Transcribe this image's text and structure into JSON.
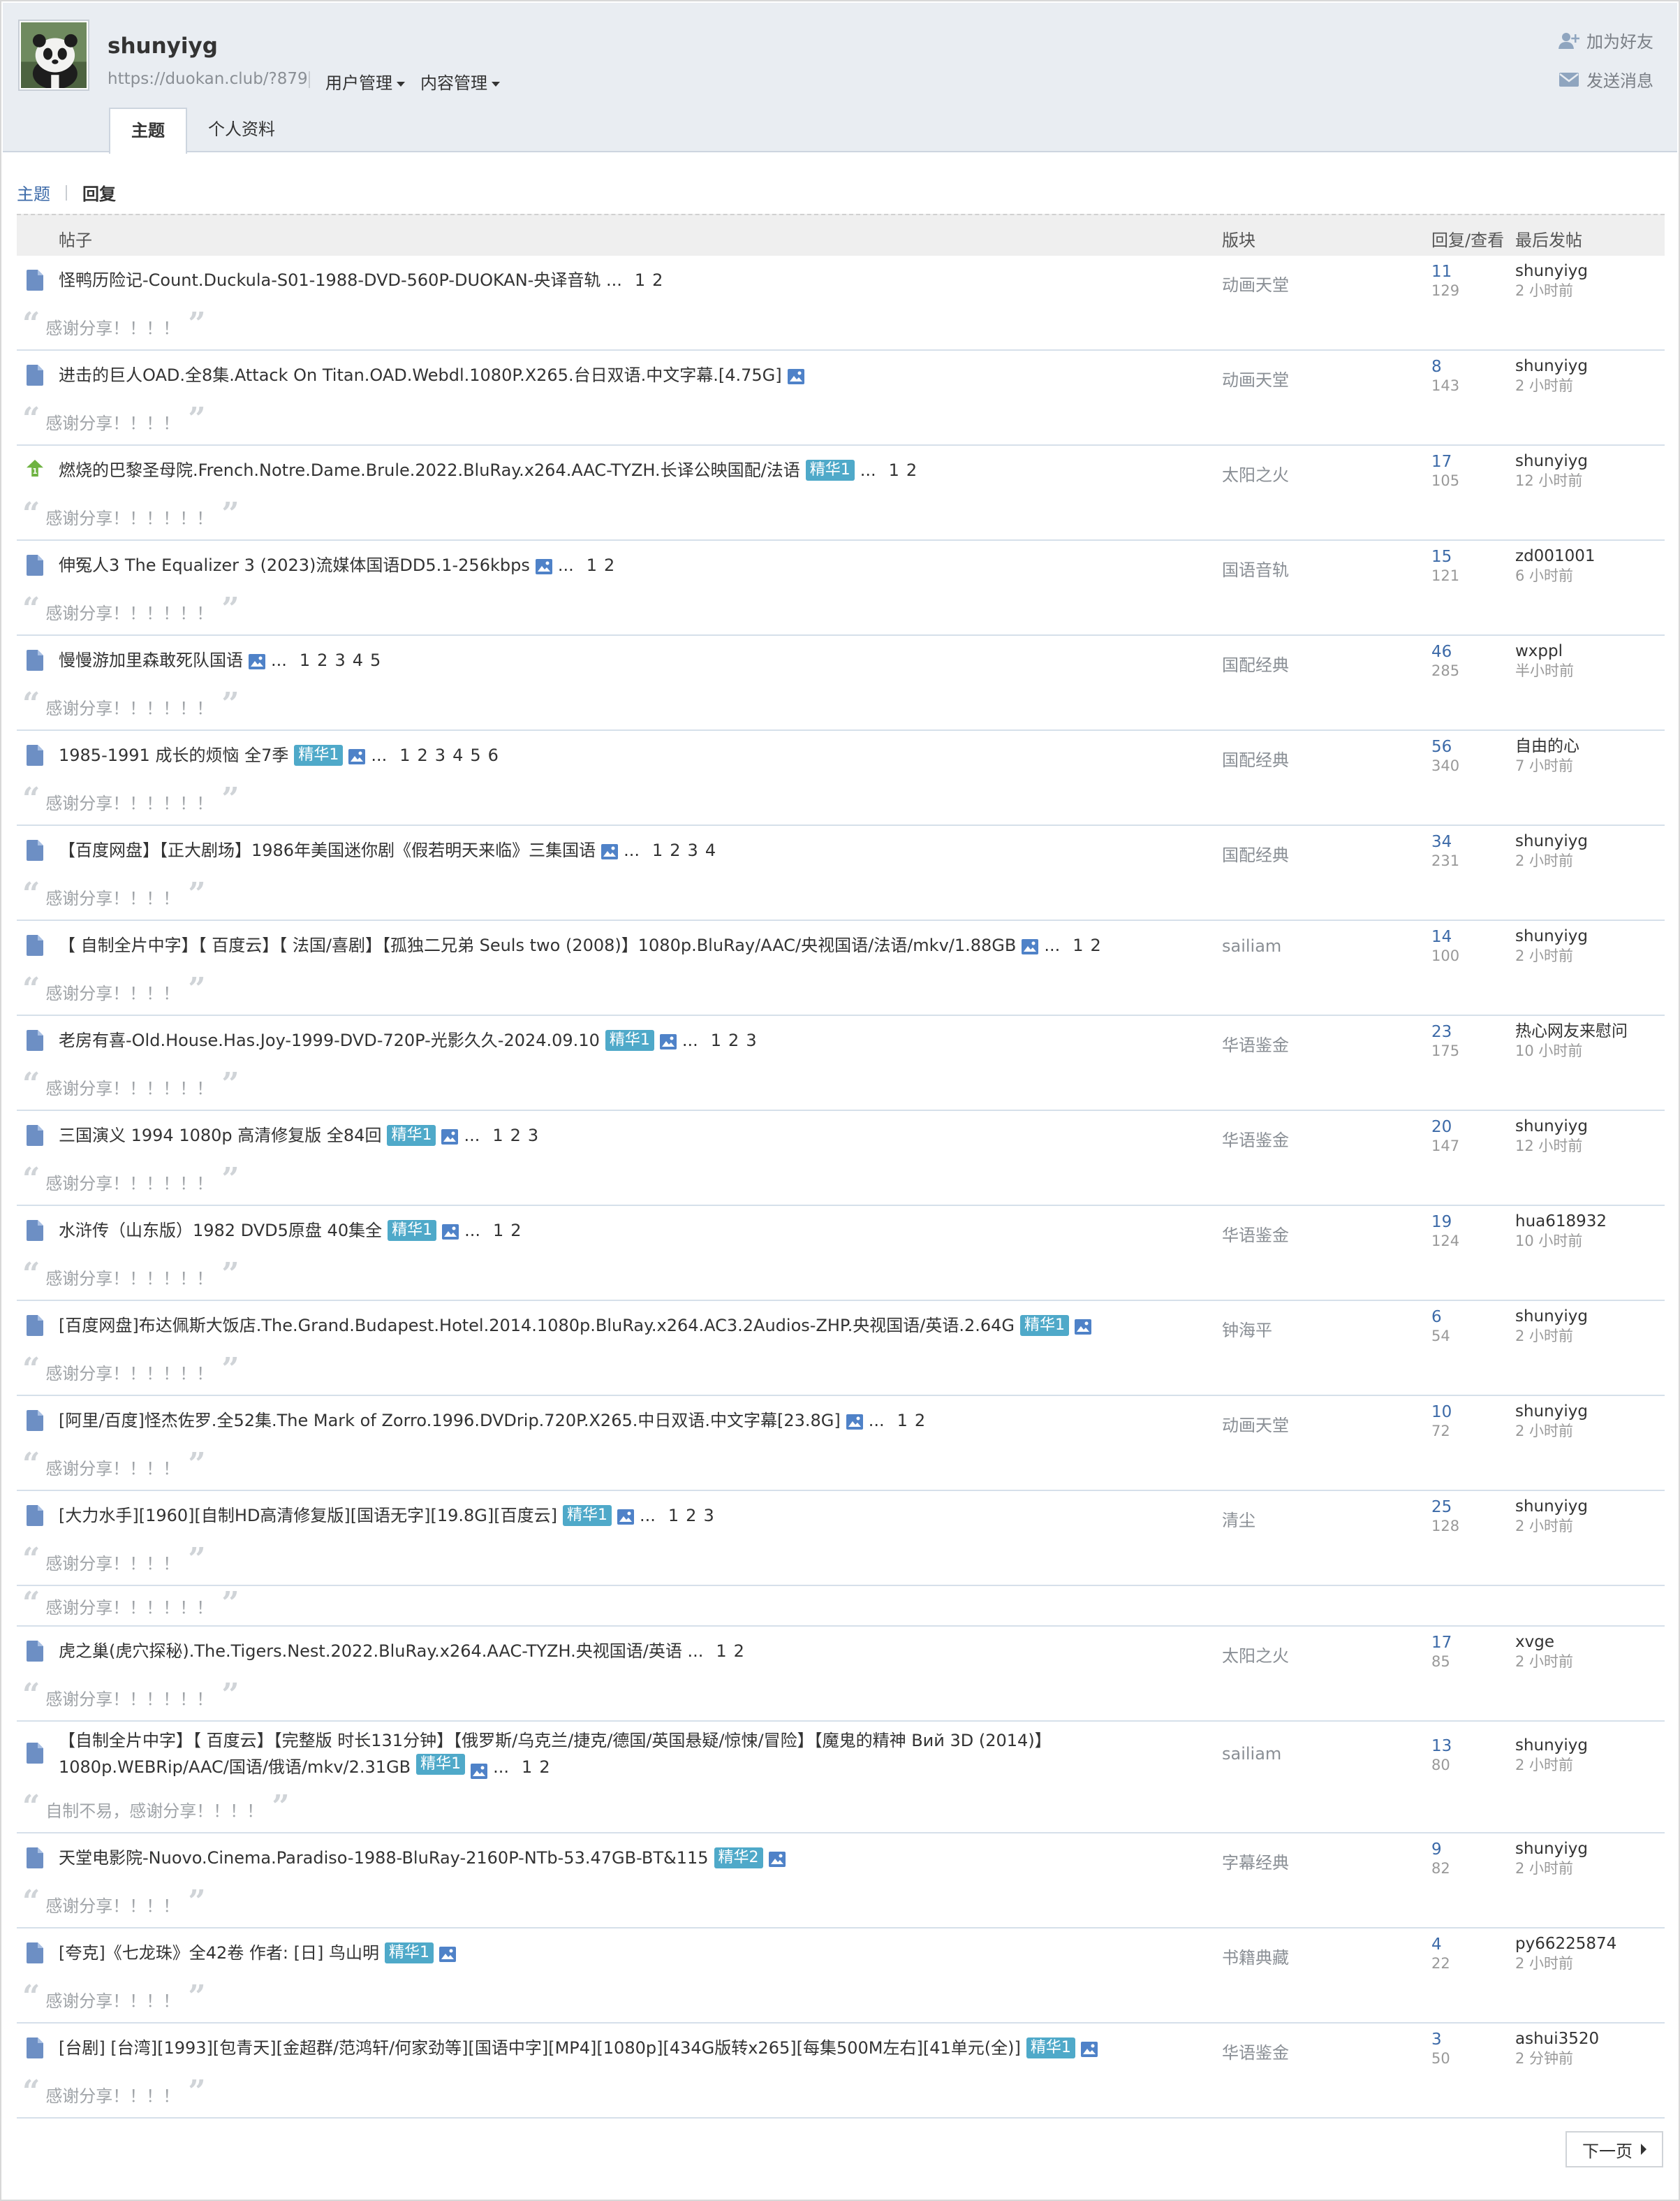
{
  "header": {
    "username": "shunyiyg",
    "url": "https://duokan.club/?879",
    "menu": [
      "用户管理",
      "内容管理"
    ],
    "actions": {
      "add_friend": "加为好友",
      "send_message": "发送消息"
    },
    "tabs": [
      "主题",
      "个人资料"
    ]
  },
  "subnav": {
    "topics": "主题",
    "replies": "回复"
  },
  "table": {
    "col_post": "帖子",
    "col_forum": "版块",
    "col_reply": "回复/查看",
    "col_last": "最后发帖"
  },
  "posts": [
    {
      "title": "怪鸭历险记-Count.Duckula-S01-1988-DVD-560P-DUOKAN-央译音轨 ...",
      "pages": [
        "1",
        "2"
      ],
      "forum": "动画天堂",
      "replies": "11",
      "views": "129",
      "last_user": "shunyiyg",
      "last_time": "2 小时前",
      "quote": "感谢分享！！！！",
      "up": false
    },
    {
      "title": "进击的巨人OAD.全8集.Attack On Titan.OAD.Webdl.1080P.X265.台日双语.中文字幕.[4.75G]",
      "image": true,
      "forum": "动画天堂",
      "replies": "8",
      "views": "143",
      "last_user": "shunyiyg",
      "last_time": "2 小时前",
      "quote": "感谢分享！！！！",
      "up": false
    },
    {
      "title": "燃烧的巴黎圣母院.French.Notre.Dame.Brule.2022.BluRay.x264.AAC-TYZH.长译公映国配/法语",
      "badge": "精华1",
      "ellipsis": "...",
      "pages": [
        "1",
        "2"
      ],
      "forum": "太阳之火",
      "replies": "17",
      "views": "105",
      "last_user": "shunyiyg",
      "last_time": "12 小时前",
      "quote": "感谢分享！！！！！！",
      "up": true
    },
    {
      "title": "伸冤人3 The Equalizer 3 (2023)流媒体国语DD5.1-256kbps",
      "image": true,
      "ellipsis": "...",
      "pages": [
        "1",
        "2"
      ],
      "forum": "国语音轨",
      "replies": "15",
      "views": "121",
      "last_user": "zd001001",
      "last_time": "6 小时前",
      "quote": "感谢分享！！！！！！",
      "up": false
    },
    {
      "title": "慢慢游加里森敢死队国语",
      "image": true,
      "ellipsis": "...",
      "pages": [
        "1",
        "2",
        "3",
        "4",
        "5"
      ],
      "forum": "国配经典",
      "replies": "46",
      "views": "285",
      "last_user": "wxppl",
      "last_time": "半小时前",
      "quote": "感谢分享！！！！！！",
      "up": false
    },
    {
      "title": "1985-1991 成长的烦恼 全7季",
      "badge": "精华1",
      "image": true,
      "ellipsis": "...",
      "pages": [
        "1",
        "2",
        "3",
        "4",
        "5",
        "6"
      ],
      "forum": "国配经典",
      "replies": "56",
      "views": "340",
      "last_user": "自由的心",
      "last_time": "7 小时前",
      "quote": "感谢分享！！！！！！",
      "up": false
    },
    {
      "title": "【百度网盘】【正大剧场】1986年美国迷你剧《假若明天来临》三集国语",
      "image": true,
      "ellipsis": "...",
      "pages": [
        "1",
        "2",
        "3",
        "4"
      ],
      "forum": "国配经典",
      "replies": "34",
      "views": "231",
      "last_user": "shunyiyg",
      "last_time": "2 小时前",
      "quote": "感谢分享！！！！",
      "up": false
    },
    {
      "title": "【 自制全片中字】【 百度云】【 法国/喜剧】【孤独二兄弟 Seuls two (2008)】1080p.BluRay/AAC/央视国语/法语/mkv/1.88GB",
      "image": true,
      "ellipsis": "...",
      "pages": [
        "1",
        "2"
      ],
      "forum": "sailiam",
      "replies": "14",
      "views": "100",
      "last_user": "shunyiyg",
      "last_time": "2 小时前",
      "quote": "感谢分享！！！！",
      "up": false
    },
    {
      "title": "老房有喜-Old.House.Has.Joy-1999-DVD-720P-光影久久-2024.09.10",
      "badge": "精华1",
      "image": true,
      "ellipsis": "...",
      "pages": [
        "1",
        "2",
        "3"
      ],
      "forum": "华语鉴金",
      "replies": "23",
      "views": "175",
      "last_user": "热心网友来慰问",
      "last_time": "10 小时前",
      "quote": "感谢分享！！！！！！",
      "up": false
    },
    {
      "title": "三国演义 1994 1080p 高清修复版 全84回",
      "badge": "精华1",
      "image": true,
      "ellipsis": "...",
      "pages": [
        "1",
        "2",
        "3"
      ],
      "forum": "华语鉴金",
      "replies": "20",
      "views": "147",
      "last_user": "shunyiyg",
      "last_time": "12 小时前",
      "quote": "感谢分享！！！！！！",
      "up": false
    },
    {
      "title": "水浒传（山东版）1982 DVD5原盘 40集全",
      "badge": "精华1",
      "image": true,
      "ellipsis": "...",
      "pages": [
        "1",
        "2"
      ],
      "forum": "华语鉴金",
      "replies": "19",
      "views": "124",
      "last_user": "hua618932",
      "last_time": "10 小时前",
      "quote": "感谢分享！！！！！！",
      "up": false
    },
    {
      "title": "[百度网盘]布达佩斯大饭店.The.Grand.Budapest.Hotel.2014.1080p.BluRay.x264.AC3.2Audios-ZHP.央视国语/英语.2.64G",
      "badge": "精华1",
      "image": true,
      "forum": "钟海平",
      "replies": "6",
      "views": "54",
      "last_user": "shunyiyg",
      "last_time": "2 小时前",
      "quote": "感谢分享！！！！！！",
      "up": false
    },
    {
      "title": "[阿里/百度]怪杰佐罗.全52集.The Mark of Zorro.1996.DVDrip.720P.X265.中日双语.中文字幕[23.8G]",
      "image": true,
      "ellipsis": "...",
      "pages": [
        "1",
        "2"
      ],
      "forum": "动画天堂",
      "replies": "10",
      "views": "72",
      "last_user": "shunyiyg",
      "last_time": "2 小时前",
      "quote": "感谢分享！！！！",
      "up": false
    },
    {
      "title": "[大力水手][1960][自制HD高清修复版][国语无字][19.8G][百度云]",
      "badge": "精华1",
      "image": true,
      "ellipsis": "...",
      "pages": [
        "1",
        "2",
        "3"
      ],
      "forum": "清尘",
      "replies": "25",
      "views": "128",
      "last_user": "shunyiyg",
      "last_time": "2 小时前",
      "quote": "感谢分享！！！！",
      "extra_quote": "感谢分享！！！！！！",
      "up": false
    },
    {
      "title": "虎之巢(虎穴探秘).The.Tigers.Nest.2022.BluRay.x264.AAC-TYZH.央视国语/英语 ...",
      "pages": [
        "1",
        "2"
      ],
      "forum": "太阳之火",
      "replies": "17",
      "views": "85",
      "last_user": "xvge",
      "last_time": "2 小时前",
      "quote": "感谢分享！！！！！！",
      "up": false
    },
    {
      "title": "【自制全片中字】【 百度云】【完整版 时长131分钟】【俄罗斯/乌克兰/捷克/德国/英国悬疑/惊悚/冒险】【魔鬼的精神 Вий 3D (2014)】1080p.WEBRip/AAC/国语/俄语/mkv/2.31GB",
      "badge": "精华1",
      "image": true,
      "ellipsis": "...",
      "pages": [
        "1",
        "2"
      ],
      "forum": "sailiam",
      "replies": "13",
      "views": "80",
      "last_user": "shunyiyg",
      "last_time": "2 小时前",
      "quote": "自制不易，感谢分享！！！！",
      "tall": true,
      "up": false
    },
    {
      "title": "天堂电影院-Nuovo.Cinema.Paradiso-1988-BluRay-2160P-NTb-53.47GB-BT&115",
      "badge": "精华2",
      "image": true,
      "forum": "字幕经典",
      "replies": "9",
      "views": "82",
      "last_user": "shunyiyg",
      "last_time": "2 小时前",
      "quote": "感谢分享！！！！",
      "up": false
    },
    {
      "title": "[夸克]《七龙珠》全42卷 作者: [日] 鸟山明",
      "badge": "精华1",
      "image": true,
      "forum": "书籍典藏",
      "replies": "4",
      "views": "22",
      "last_user": "py66225874",
      "last_time": "2 小时前",
      "quote": "感谢分享！！！！",
      "up": false
    },
    {
      "title": "[台剧] [台湾][1993][包青天][金超群/范鸿轩/何家劲等][国语中字][MP4][1080p][434G版转x265][每集500M左右][41单元(全)]",
      "badge": "精华1",
      "image": true,
      "forum": "华语鉴金",
      "replies": "3",
      "views": "50",
      "last_user": "ashui3520",
      "last_time": "2 分钟前",
      "quote": "感谢分享！！！！",
      "up": false
    }
  ],
  "pagination": {
    "next": "下一页"
  }
}
